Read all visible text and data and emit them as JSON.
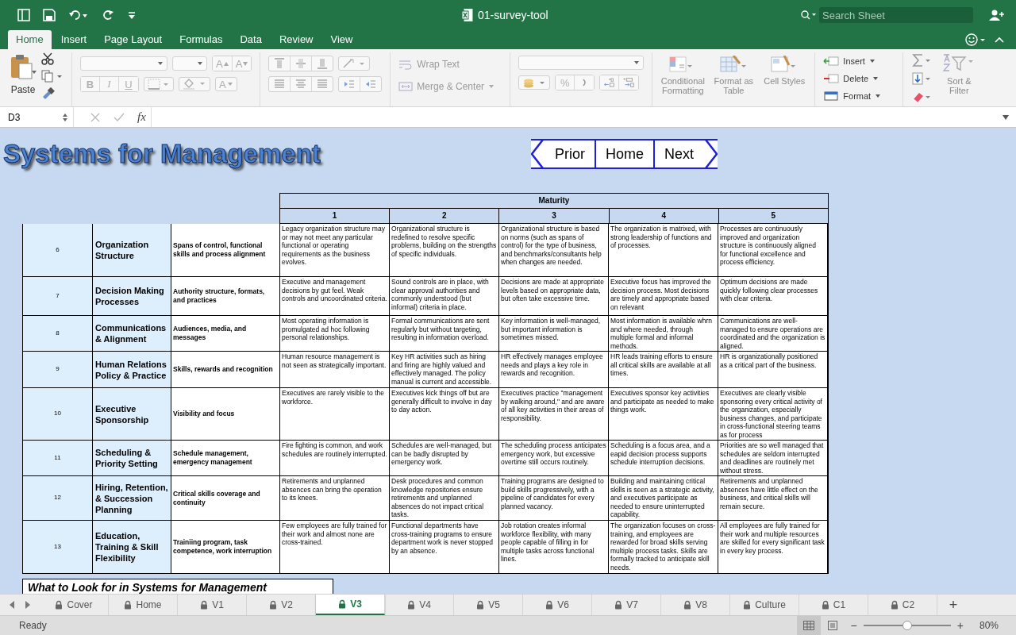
{
  "window": {
    "title": "01-survey-tool",
    "search": {
      "placeholder": "Search Sheet"
    }
  },
  "ribbon_tabs": [
    {
      "label": "Home",
      "selected": true
    },
    {
      "label": "Insert",
      "selected": false
    },
    {
      "label": "Page Layout",
      "selected": false
    },
    {
      "label": "Formulas",
      "selected": false
    },
    {
      "label": "Data",
      "selected": false
    },
    {
      "label": "Review",
      "selected": false
    },
    {
      "label": "View",
      "selected": false
    }
  ],
  "ribbon": {
    "paste": "Paste",
    "size_buttons": [
      "A",
      "A"
    ],
    "style_buttons": [
      "B",
      "I",
      "U"
    ],
    "font_color": "A",
    "wrap_text": {
      "label": "Wrap Text",
      "disabled": true
    },
    "merge": {
      "label": "Merge & Center",
      "disabled": true
    },
    "percent": "%",
    "style_commands": [
      {
        "label": "Conditional Formatting",
        "disabled": true
      },
      {
        "label": "Format as Table",
        "disabled": true
      },
      {
        "label": "Cell Styles",
        "disabled": true
      }
    ],
    "cell_commands": [
      {
        "label": "Insert",
        "disabled": false
      },
      {
        "label": "Delete",
        "disabled": false
      },
      {
        "label": "Format",
        "disabled": false
      }
    ],
    "sort_filter": {
      "label": "Sort & Filter",
      "disabled": true
    }
  },
  "formula_bar": {
    "cell_ref": "D3",
    "fx": "fx"
  },
  "sheet": {
    "title": "Systems for Management",
    "nav_buttons": [
      "Prior",
      "Home",
      "Next"
    ],
    "table": {
      "group_header": "Maturity",
      "levels": [
        "1",
        "2",
        "3",
        "4",
        "5"
      ],
      "rows": [
        {
          "number": "6",
          "area": "Organization Structure",
          "focus": "Spans of control, functional skills and process alignment",
          "cells": [
            "Legacy organization structure may or may not meet any particular functional or operating requirements as the business evolves.",
            "Organizational structure is redefined to resolve specific problems, building on the strengths of specific individuals.",
            "Organizational structure is based on norms (such as spans of control) for the type of business, and benchmarks/consultants help when changes are needed.",
            "The organization is matrixed, with strong leadership of functions and of processes.",
            "Processes are continuously improved  and organization structure is continuously  aligned for functional excellence and process efficiency."
          ]
        },
        {
          "number": "7",
          "area": "Decision Making Processes",
          "focus": "Authority structure, formats, and practices",
          "cells": [
            "Executive and management decisions by gut feel. Weak controls and uncoordinated criteria.",
            "Sound controls are in place, with clear approval authorities and commonly understood (but informal) criteria in place.",
            "Decisions are made at appropriate levels based on appropriate data, but often take excessive time.",
            "Executive focus has improved the decision process. Most decisions are timely and appropriate based on relevant",
            "Optimum decisions are made quickly following clear processes with clear criteria."
          ]
        },
        {
          "number": "8",
          "area": "Communications & Alignment",
          "focus": "Audiences, media, and messages",
          "cells": [
            "Most operating information is promulgated ad hoc following personal relationships.",
            "Formal communications are sent regularly but without targeting, resulting in information overload.",
            "Key information is well-managed, but important information is sometimes missed.",
            "Most information is available whrn and where needed, through multiple formal and informal methods.",
            "Communications are well-managed to ensure operations are coordinated and the organization is aligned."
          ]
        },
        {
          "number": "9",
          "area": "Human Relations Policy & Practice",
          "focus": "Skills, rewards and recognition",
          "cells": [
            "Human resource management is not seen as strategically important.",
            "Key HR activities such as hiring and firing are highly valued and effectively managed. The policy manual is current and accessible.",
            "HR effectively manages employee needs and plays a key role in rewards and recognition.",
            "HR leads training efforts to ensure all critical skills are available at all times.",
            "HR is organizationally positioned as a critical part of the business."
          ]
        },
        {
          "number": "10",
          "area": "Executive Sponsorship",
          "focus": "Visibility and focus",
          "cells": [
            "Executives are rarely visible to the workforce.",
            "Executives kick things off but are generally difficult to involve in day to day action.",
            "Executives practice \"management by walking around,\" and are aware of all key activities in their areas of responsibility.",
            "Executives sponsor key activities and participate as needed to make things work.",
            "Executives are clearly visible sponsoring every critical activity of the organization, especially business changes, and participate in cross-functional steering teams as for process"
          ]
        },
        {
          "number": "11",
          "area": "Scheduling & Priority Setting",
          "focus": "Schedule management, emergency management",
          "cells": [
            "Fire fighting is common, and work schedules are routinely interrupted.",
            "Schedules are well-managed, but can be badly disrupted by emergency work.",
            "The scheduling process anticipates emergency work, but excessive overtime still occurs routinely.",
            "Scheduling is a focus area, and a eapid decision process supports schedule interruption decisions.",
            "Priorities are so well managed that schedules are seldom interrupted and deadlines are routinely met without stress."
          ]
        },
        {
          "number": "12",
          "area": "Hiring, Retention, & Succession Planning",
          "focus": "Critical skills coverage and continuity",
          "cells": [
            "Retirements and unplanned absences can bring the operation to its knees.",
            "Desk procedures and common knowledge repositories ensure retirements and unplanned absences do not impact critical tasks.",
            "Training programs are designed to build skills progressively, with a pipeline of candidates for every planned vacancy.",
            "Building and maintaining critical skills is seen as a strategic activity, and executives participate as needed to ensure uninterrupted capability.",
            "Retirements and unplanned absences have little effect on the business, and critical skills will remain secure."
          ]
        },
        {
          "number": "13",
          "area": "Education, Training & Skill Flexibility",
          "focus": "Trainiing program, task competence, work interruption",
          "cells": [
            "Few employees are fully trained for their work and almost none are cross-trained.",
            "Functional departments have cross-training programs to ensure department work is never stopped by an absence.",
            "Job rotation creates informal workforce flexibility, with many people capable of filling in for multiple tasks across functional lines.",
            "The organization focuses on cross-training, and employees are rewarded for broad skills serving multiple process tasks. Skills are formally tracked to anticipate skill needs.",
            "All employees are fully trained for their work and multiple resources are skilled for every significant task in every key process."
          ]
        }
      ]
    },
    "note_box": "What to Look for in Systems for Management"
  },
  "sheet_tabs": [
    {
      "label": "Cover",
      "locked": true,
      "selected": false
    },
    {
      "label": "Home",
      "locked": true,
      "selected": false
    },
    {
      "label": "V1",
      "locked": true,
      "selected": false
    },
    {
      "label": "V2",
      "locked": true,
      "selected": false
    },
    {
      "label": "V3",
      "locked": true,
      "selected": true
    },
    {
      "label": "V4",
      "locked": true,
      "selected": false
    },
    {
      "label": "V5",
      "locked": true,
      "selected": false
    },
    {
      "label": "V6",
      "locked": true,
      "selected": false
    },
    {
      "label": "V7",
      "locked": true,
      "selected": false
    },
    {
      "label": "V8",
      "locked": true,
      "selected": false
    },
    {
      "label": "Culture",
      "locked": true,
      "selected": false
    },
    {
      "label": "C1",
      "locked": true,
      "selected": false
    },
    {
      "label": "C2",
      "locked": true,
      "selected": false
    }
  ],
  "add_sheet": "+",
  "status_bar": {
    "status": "Ready",
    "zoom_minus": "−",
    "zoom_plus": "+",
    "zoom_slider": {
      "level": 0.5
    },
    "zoom": "80%"
  }
}
